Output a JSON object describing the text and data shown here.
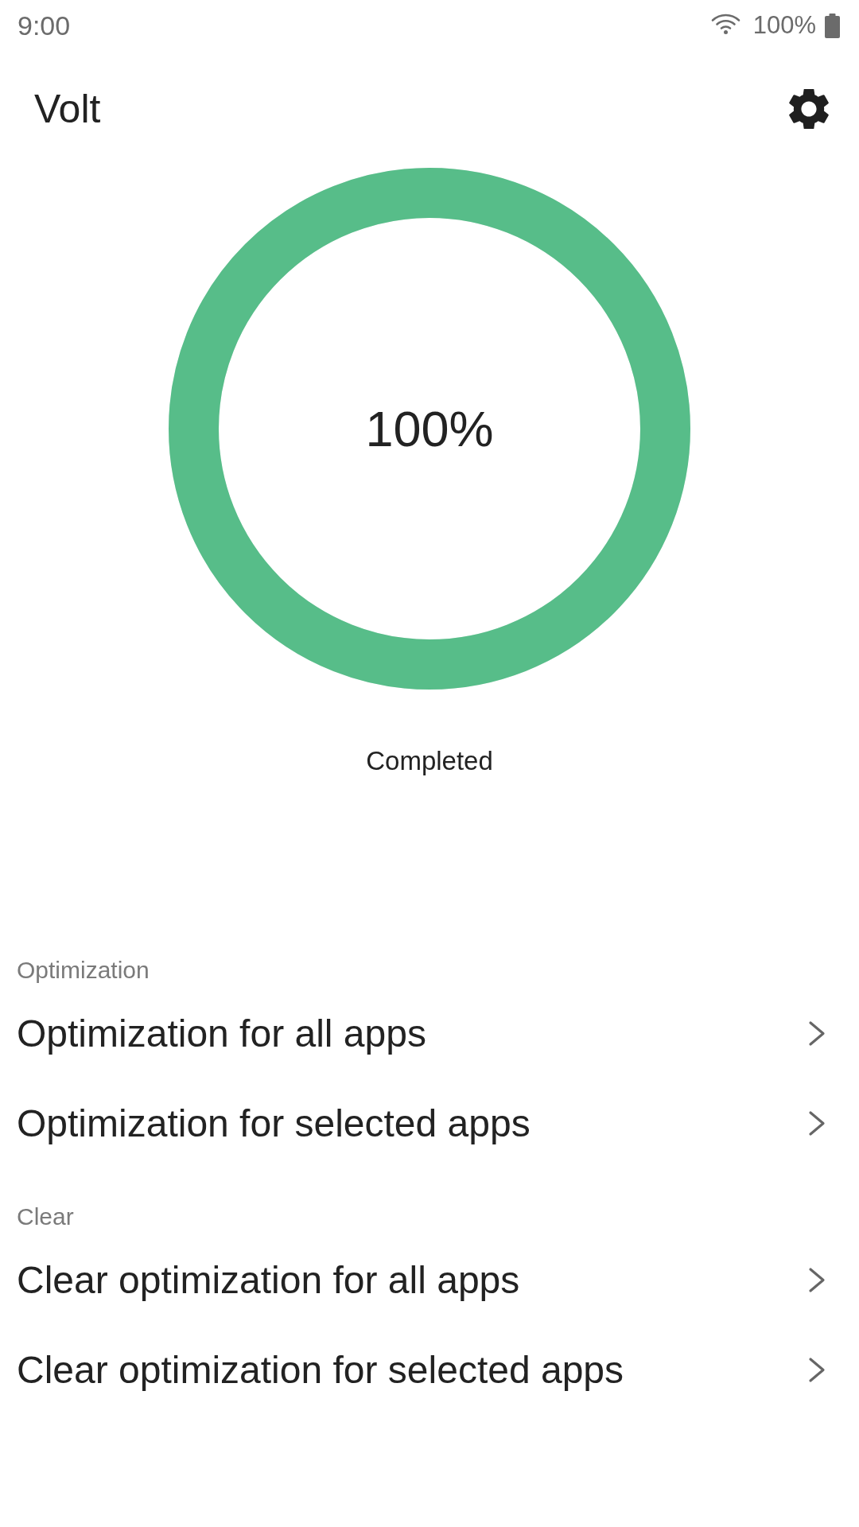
{
  "status_bar": {
    "time": "9:00",
    "battery": "100%"
  },
  "app_bar": {
    "title": "Volt"
  },
  "progress": {
    "level": 1,
    "reading": "100%",
    "caption": "Completed"
  },
  "sections": [
    {
      "header": "Optimization",
      "items": [
        {
          "label": "Optimization for all apps"
        },
        {
          "label": "Optimization for selected apps"
        }
      ]
    },
    {
      "header": "Clear",
      "items": [
        {
          "label": "Clear optimization for all apps"
        },
        {
          "label": "Clear optimization for selected apps"
        }
      ]
    }
  ]
}
